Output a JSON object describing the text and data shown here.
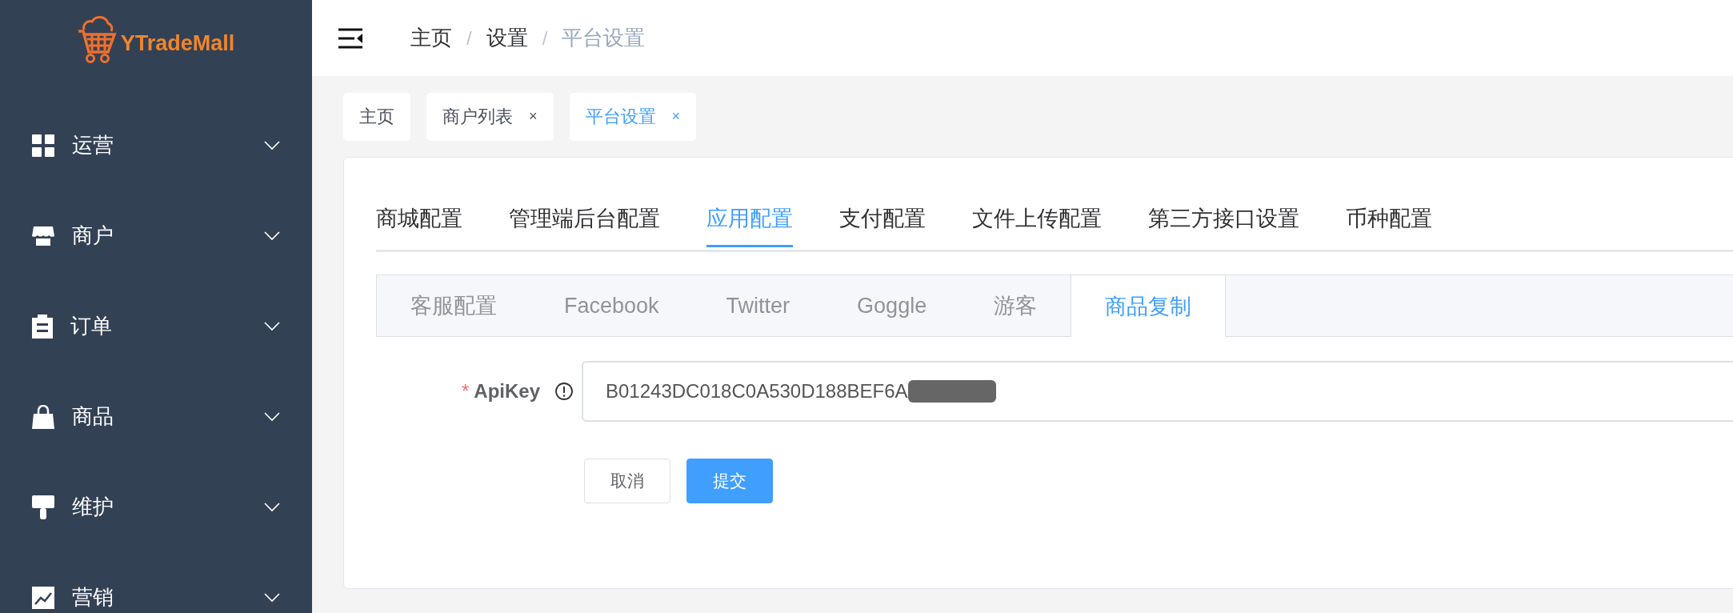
{
  "sidebar": {
    "logo": "YTradeMall",
    "items": [
      {
        "label": "运营",
        "expanded": false
      },
      {
        "label": "商户",
        "expanded": false
      },
      {
        "label": "订单",
        "expanded": false
      },
      {
        "label": "商品",
        "expanded": false
      },
      {
        "label": "维护",
        "expanded": false
      },
      {
        "label": "营销",
        "expanded": false
      }
    ]
  },
  "breadcrumb": [
    {
      "kind": "link",
      "text": "主页"
    },
    {
      "kind": "separator",
      "text": "/"
    },
    {
      "kind": "link",
      "text": "设置"
    },
    {
      "kind": "separator",
      "text": "/"
    },
    {
      "kind": "current",
      "text": "平台设置"
    }
  ],
  "tags": [
    {
      "label": "主页",
      "selected": false
    },
    {
      "label": "商户列表",
      "close": "×",
      "selected": false
    },
    {
      "label": "平台设置",
      "close": "×",
      "selected": true
    }
  ],
  "tabs": [
    {
      "label": "商城配置",
      "selected": false
    },
    {
      "label": "管理端后台配置",
      "selected": false
    },
    {
      "label": "应用配置",
      "selected": true
    },
    {
      "label": "支付配置",
      "selected": false
    },
    {
      "label": "文件上传配置",
      "selected": false
    },
    {
      "label": "第三方接口设置",
      "selected": false
    },
    {
      "label": "币种配置",
      "selected": false
    }
  ],
  "sub_tabs": [
    {
      "label": "客服配置",
      "selected": false
    },
    {
      "label": "Facebook",
      "selected": false
    },
    {
      "label": "Twitter",
      "selected": false
    },
    {
      "label": "Goggle",
      "selected": false
    },
    {
      "label": "游客",
      "selected": false
    },
    {
      "label": "商品复制",
      "selected": true
    }
  ],
  "form": {
    "field": {
      "label": "ApiKey",
      "required_mark": "*",
      "value": "B01243DC018C0A530D188BEF6A",
      "redacted": true
    },
    "buttons": [
      {
        "label": "取消",
        "kind": "default"
      },
      {
        "label": "提交",
        "kind": "primary"
      }
    ]
  }
}
